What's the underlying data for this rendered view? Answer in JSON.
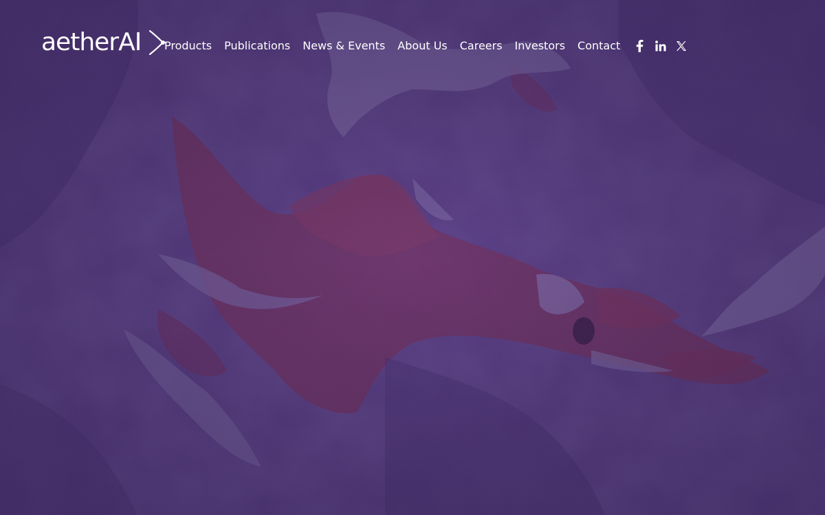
{
  "brand": {
    "name": "aetherAI"
  },
  "nav": {
    "items": [
      {
        "label": "Products"
      },
      {
        "label": "Publications"
      },
      {
        "label": "News & Events"
      },
      {
        "label": "About Us"
      },
      {
        "label": "Careers"
      },
      {
        "label": "Investors"
      },
      {
        "label": "Contact"
      }
    ]
  },
  "social": {
    "icons": [
      "facebook-icon",
      "linkedin-icon",
      "x-icon"
    ]
  },
  "colors": {
    "overlay": "#4a2f73",
    "tissue_purple": "#5d3d8a",
    "tissue_red": "#8a2f58",
    "text": "#ffffff"
  }
}
